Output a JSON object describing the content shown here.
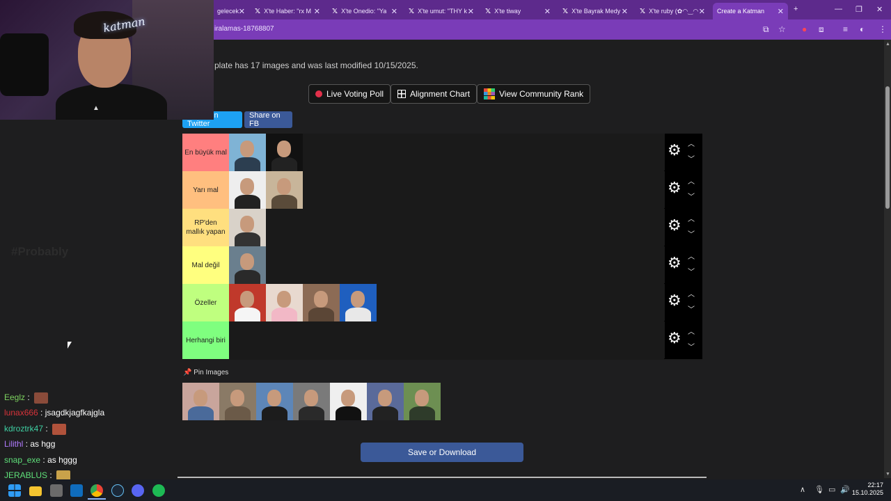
{
  "browser": {
    "tabs": [
      {
        "title": "gelecek",
        "x_logo": false
      },
      {
        "title": "X'te Haber: \"rx M",
        "x_logo": true
      },
      {
        "title": "X'te Onedio: \"Ya",
        "x_logo": true
      },
      {
        "title": "X'te umut: \"THY k",
        "x_logo": true
      },
      {
        "title": "X'te tiway",
        "x_logo": true
      },
      {
        "title": "X'te Bayrak Medy",
        "x_logo": true
      },
      {
        "title": "X'te ruby (✿◠‿◠",
        "x_logo": true
      },
      {
        "title": "Create a Katman",
        "x_logo": false,
        "active": true
      }
    ],
    "url": "iralamas-18768807",
    "new_tab": "+",
    "accent": "#7a3cb8"
  },
  "page": {
    "template_info": "plate has 17 images and was last modified 10/15/2025.",
    "buttons": {
      "live_poll": "Live Voting Poll",
      "alignment": "Alignment Chart",
      "community": "View Community Rank"
    },
    "share": {
      "twitter": "Share on Twitter",
      "fb": "Share on FB"
    },
    "tiers": [
      {
        "label": "En büyük mal",
        "color": "#ff7f7f",
        "items": 2
      },
      {
        "label": "Yarı mal",
        "color": "#ffbf7f",
        "items": 2
      },
      {
        "label": "RP'den mallık yapan",
        "color": "#ffdf7f",
        "items": 1
      },
      {
        "label": "Mal değil",
        "color": "#ffff7f",
        "items": 1
      },
      {
        "label": "Özeller",
        "color": "#bfff7f",
        "items": 4
      },
      {
        "label": "Herhangi biri",
        "color": "#7fff7f",
        "items": 0
      }
    ],
    "pin_label": "Pin Images",
    "pin_count": 7,
    "save_label": "Save or Download"
  },
  "stream": {
    "neon_sign": "katman",
    "watermark": "#Probably",
    "chat": [
      {
        "user": "Eeglz",
        "sep": " : ",
        "msg": "",
        "user_color": "#7dd35f",
        "emote": true
      },
      {
        "user": "lunax666",
        "sep": " : ",
        "msg": "jsagdkjagfkajgla",
        "user_color": "#d8333a",
        "emote": false
      },
      {
        "user": "kdroztrk47",
        "sep": " : ",
        "msg": "",
        "user_color": "#3fd0a3",
        "emote": true
      },
      {
        "user": "Lilithl",
        "sep": " : ",
        "msg": "as hgg",
        "user_color": "#b17bff",
        "emote": false
      },
      {
        "user": "snap_exe",
        "sep": " : ",
        "msg": "as hggg",
        "user_color": "#5fe07a",
        "emote": false
      },
      {
        "user": "JERABLUS",
        "sep": " : ",
        "msg": "",
        "user_color": "#5fe07a",
        "emote": true
      }
    ]
  },
  "taskbar": {
    "time": "22:17",
    "date": "15.10.2025"
  }
}
